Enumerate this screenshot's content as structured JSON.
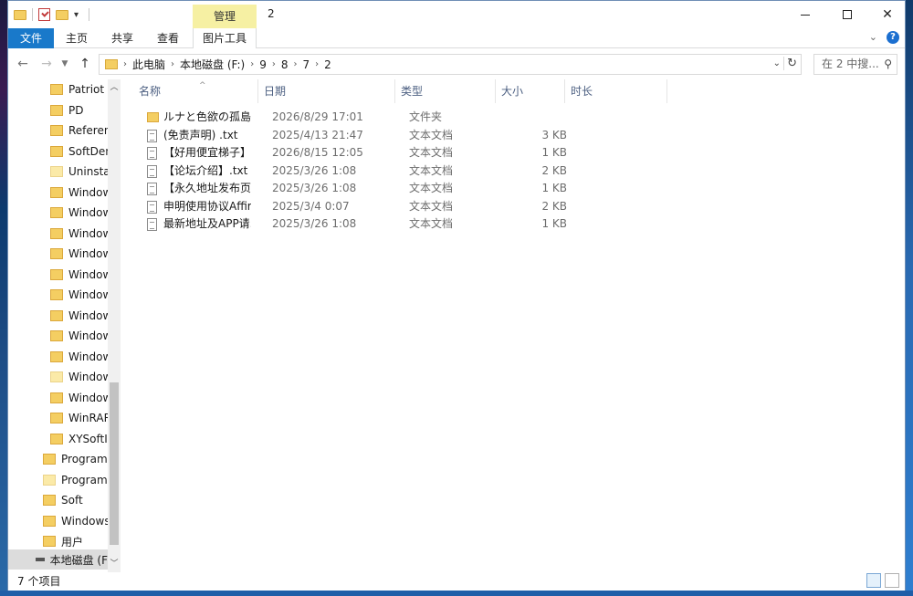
{
  "window": {
    "title": "2",
    "manage_tab": "管理"
  },
  "ribbon": {
    "file": "文件",
    "home": "主页",
    "share": "共享",
    "view": "查看",
    "picture_tools": "图片工具"
  },
  "address": {
    "crumbs": [
      "此电脑",
      "本地磁盘 (F:)",
      "9",
      "8",
      "7",
      "2"
    ]
  },
  "search": {
    "placeholder": "在 2 中搜..."
  },
  "nav_pane": {
    "items": [
      "Patriot",
      "PD",
      "Referen",
      "SoftDen",
      "Uninstal",
      "Window",
      "Window",
      "Window",
      "Window",
      "Window",
      "Window",
      "Window",
      "Window",
      "Window",
      "Window",
      "Window",
      "WinRAR",
      "XYSoftIr",
      "Program",
      "ProgramD",
      "Soft",
      "Windows",
      "用户"
    ],
    "drive": "本地磁盘 (F"
  },
  "columns": {
    "name": "名称",
    "date": "日期",
    "type": "类型",
    "size": "大小",
    "duration": "时长"
  },
  "files": [
    {
      "name": "ルナと色欲の孤島d...",
      "date": "2026/8/29 17:01",
      "type": "文件夹",
      "size": "",
      "kind": "folder"
    },
    {
      "name": "(免责声明) .txt",
      "date": "2025/4/13 21:47",
      "type": "文本文档",
      "size": "3 KB",
      "kind": "txt"
    },
    {
      "name": "【好用便宜梯子】.txt",
      "date": "2026/8/15 12:05",
      "type": "文本文档",
      "size": "1 KB",
      "kind": "txt"
    },
    {
      "name": "【论坛介绍】.txt",
      "date": "2025/3/26 1:08",
      "type": "文本文档",
      "size": "2 KB",
      "kind": "txt"
    },
    {
      "name": "【永久地址发布页...",
      "date": "2025/3/26 1:08",
      "type": "文本文档",
      "size": "1 KB",
      "kind": "txt"
    },
    {
      "name": "申明使用协议Affir...",
      "date": "2025/3/4 0:07",
      "type": "文本文档",
      "size": "2 KB",
      "kind": "txt"
    },
    {
      "name": "最新地址及APP请...",
      "date": "2025/3/26 1:08",
      "type": "文本文档",
      "size": "1 KB",
      "kind": "txt"
    }
  ],
  "status": {
    "count": "7 个项目"
  }
}
